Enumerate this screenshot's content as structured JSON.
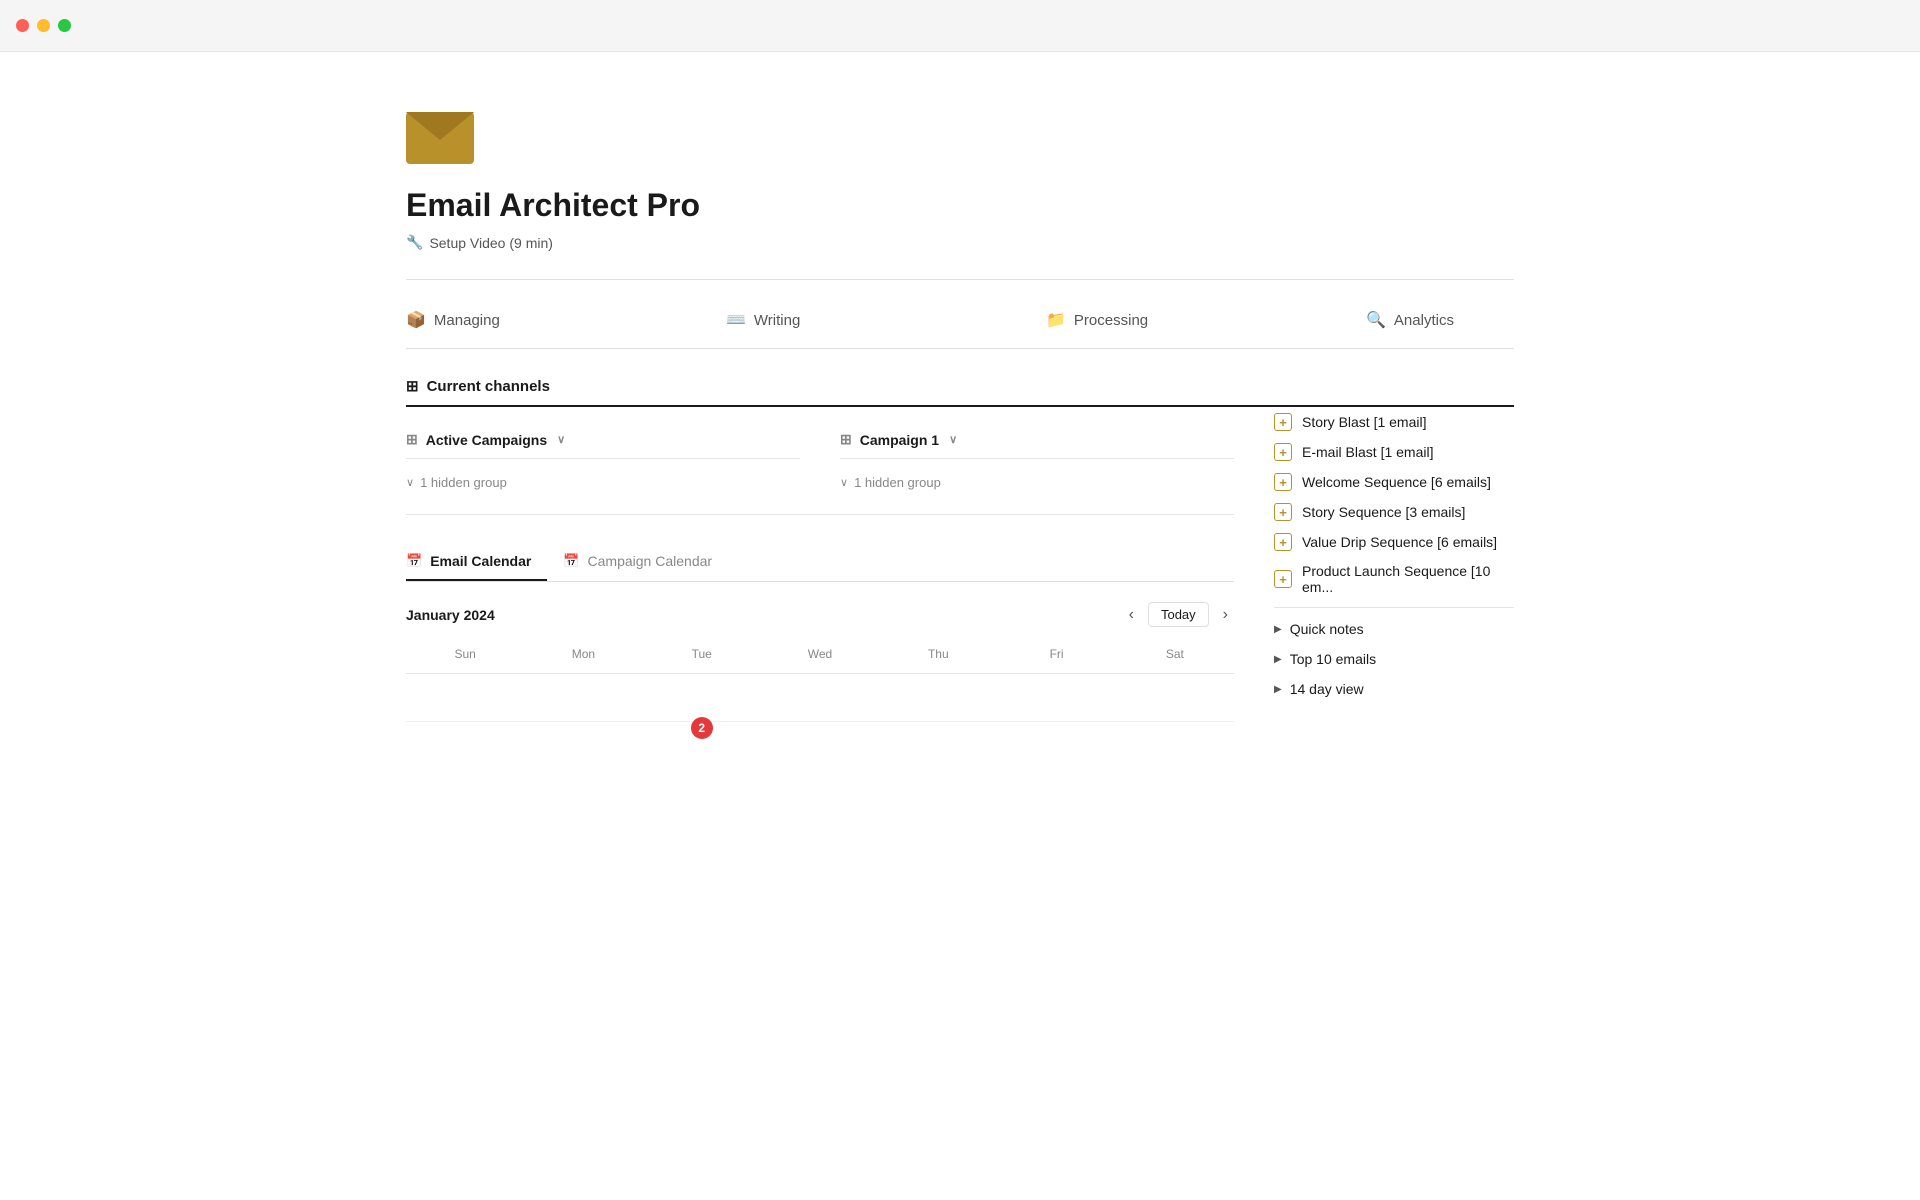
{
  "titlebar": {
    "buttons": [
      "close",
      "minimize",
      "maximize"
    ]
  },
  "header": {
    "app_title": "Email Architect Pro",
    "setup_link": "Setup Video (9 min)"
  },
  "nav": {
    "items": [
      {
        "id": "managing",
        "label": "Managing",
        "icon": "📦"
      },
      {
        "id": "writing",
        "label": "Writing",
        "icon": "⌨️"
      },
      {
        "id": "processing",
        "label": "Processing",
        "icon": "📁"
      },
      {
        "id": "analytics",
        "label": "Analytics",
        "icon": "🔍"
      }
    ]
  },
  "current_channels": {
    "section_title": "Current channels"
  },
  "active_campaigns": {
    "title": "Active Campaigns",
    "hidden_group": "1 hidden group"
  },
  "campaign1": {
    "title": "Campaign 1",
    "hidden_group": "1 hidden group"
  },
  "sidebar": {
    "sequences": [
      {
        "label": "Story Blast [1 email]"
      },
      {
        "label": "E-mail Blast [1 email]"
      },
      {
        "label": "Welcome Sequence [6 emails]"
      },
      {
        "label": "Story Sequence [3 emails]"
      },
      {
        "label": "Value Drip Sequence [6 emails]"
      },
      {
        "label": "Product Launch Sequence [10 em..."
      }
    ],
    "toggles": [
      {
        "label": "Quick notes"
      },
      {
        "label": "Top 10 emails"
      },
      {
        "label": "14 day view"
      }
    ]
  },
  "calendar": {
    "tabs": [
      {
        "label": "Email Calendar",
        "icon": "📅",
        "active": true
      },
      {
        "label": "Campaign Calendar",
        "icon": "📅",
        "active": false
      }
    ],
    "month": "January 2024",
    "today_label": "Today",
    "nav_prev": "‹",
    "nav_next": "›",
    "days_of_week": [
      "Sun",
      "Mon",
      "Tue",
      "Wed",
      "Thu",
      "Fri",
      "Sat"
    ]
  }
}
